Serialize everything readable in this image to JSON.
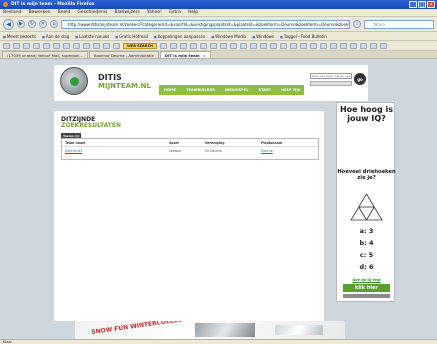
{
  "window": {
    "title": "DIT is mijn team - Mozilla Firefox"
  },
  "menu": [
    "Bestand",
    "Bewerken",
    "Beeld",
    "Geschiedenis",
    "Bladwijzers",
    "Yahoo!",
    "Extra",
    "Help"
  ],
  "nav": {
    "url": "http://www.ditismijnteam.nl/zoeken/?categoriesId=&soortId=&vestigingsplaatsId=&plaatsId=&zoekterm=Deurne&zoekterm=Deurne&zoekvestigingsplaats=&plaats=Deurne",
    "search_placeholder": "Yahoo"
  },
  "bookmarks": [
    "Meest bezocht",
    "Aan de slag",
    "Laatste nieuws",
    "Gratis Hotmail",
    "Koppelingen aanpassen",
    "Windows Media",
    "Windows",
    "Toggel - Food Bulletin"
  ],
  "toolbar": {
    "web_search": "WEB SEARCH"
  },
  "tabs": [
    {
      "label": "(17039 unread) Yahoo! Mail, superball...",
      "active": false
    },
    {
      "label": "Bookhof Deurne - Administratie",
      "active": false
    },
    {
      "label": "DIT is mijn team",
      "active": true
    }
  ],
  "site": {
    "brand_line1": "DITIS",
    "brand_line2": "MIJNTEAM.NL",
    "nav_items": [
      "HOME",
      "TEAMBUILDER",
      "NIEUWSPEL",
      "START",
      "HELP MIJ!"
    ],
    "search_placeholder": "Zoek een team, plaats, sporten bij lijst",
    "go": "go"
  },
  "main": {
    "heading1": "DITZIJNDE",
    "heading2": "ZOEKRESULTATEN",
    "tab_label": "Teams (1)",
    "columns": [
      "Team naam",
      "Sport",
      "Vereniging",
      "Plaatsnaam"
    ],
    "rows": [
      {
        "team": "Deurne D3",
        "sport": "Voetbal",
        "club": "SV Deurne",
        "place": "Deurne"
      }
    ]
  },
  "ad": {
    "question": "Hoe hoog is jouw IQ?",
    "question2": "Hoeveel driehoeken zie je?",
    "answers": [
      "a: 3",
      "b: 4",
      "c: 5",
      "d: 6"
    ],
    "link": "Doe de IQ test",
    "button": "klik hier"
  },
  "banner": {
    "text": "SNOW FUN WINTERCOLLECTIE"
  },
  "status": {
    "text": "Klaar"
  }
}
